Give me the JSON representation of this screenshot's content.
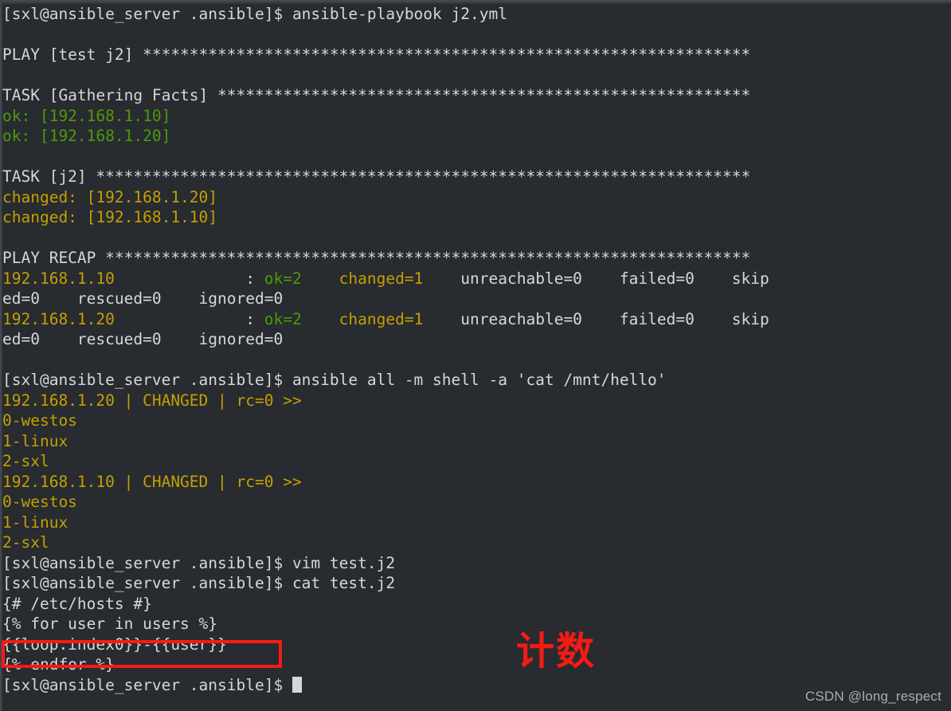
{
  "terminal": {
    "background_color": "#282b30",
    "default_text_color": "#d7d7d7",
    "ok_color": "#4e9a06",
    "changed_color": "#c4a000",
    "annotation_color": "#f51b14",
    "prompt": "[sxl@ansible_server .ansible]$ ",
    "lines": [
      {
        "id": "l01",
        "segments": [
          {
            "text": "[sxl@ansible_server .ansible]$ ansible-playbook j2.yml",
            "color": "white"
          }
        ]
      },
      {
        "id": "l02",
        "segments": [
          {
            "text": "",
            "color": "white"
          }
        ]
      },
      {
        "id": "l03",
        "segments": [
          {
            "text": "PLAY [test j2] *****************************************************************",
            "color": "white"
          }
        ]
      },
      {
        "id": "l04",
        "segments": [
          {
            "text": "",
            "color": "white"
          }
        ]
      },
      {
        "id": "l05",
        "segments": [
          {
            "text": "TASK [Gathering Facts] *********************************************************",
            "color": "white"
          }
        ]
      },
      {
        "id": "l06",
        "segments": [
          {
            "text": "ok: [192.168.1.10]",
            "color": "green"
          }
        ]
      },
      {
        "id": "l07",
        "segments": [
          {
            "text": "ok: [192.168.1.20]",
            "color": "green"
          }
        ]
      },
      {
        "id": "l08",
        "segments": [
          {
            "text": "",
            "color": "white"
          }
        ]
      },
      {
        "id": "l09",
        "segments": [
          {
            "text": "TASK [j2] **********************************************************************",
            "color": "white"
          }
        ]
      },
      {
        "id": "l10",
        "segments": [
          {
            "text": "changed: [192.168.1.20]",
            "color": "yellow"
          }
        ]
      },
      {
        "id": "l11",
        "segments": [
          {
            "text": "changed: [192.168.1.10]",
            "color": "yellow"
          }
        ]
      },
      {
        "id": "l12",
        "segments": [
          {
            "text": "",
            "color": "white"
          }
        ]
      },
      {
        "id": "l13",
        "segments": [
          {
            "text": "PLAY RECAP *********************************************************************",
            "color": "white"
          }
        ]
      },
      {
        "id": "l14",
        "segments": [
          {
            "text": "192.168.1.10",
            "color": "yellow"
          },
          {
            "text": "              : ",
            "color": "white"
          },
          {
            "text": "ok=2",
            "color": "green"
          },
          {
            "text": "    ",
            "color": "white"
          },
          {
            "text": "changed=1",
            "color": "yellow"
          },
          {
            "text": "    unreachable=0    failed=0    skip",
            "color": "white"
          }
        ]
      },
      {
        "id": "l15",
        "segments": [
          {
            "text": "ed=0    rescued=0    ignored=0   ",
            "color": "white"
          }
        ]
      },
      {
        "id": "l16",
        "segments": [
          {
            "text": "192.168.1.20",
            "color": "yellow"
          },
          {
            "text": "              : ",
            "color": "white"
          },
          {
            "text": "ok=2",
            "color": "green"
          },
          {
            "text": "    ",
            "color": "white"
          },
          {
            "text": "changed=1",
            "color": "yellow"
          },
          {
            "text": "    unreachable=0    failed=0    skip",
            "color": "white"
          }
        ]
      },
      {
        "id": "l17",
        "segments": [
          {
            "text": "ed=0    rescued=0    ignored=0   ",
            "color": "white"
          }
        ]
      },
      {
        "id": "l18",
        "segments": [
          {
            "text": "",
            "color": "white"
          }
        ]
      },
      {
        "id": "l19",
        "segments": [
          {
            "text": "[sxl@ansible_server .ansible]$ ansible all -m shell -a 'cat /mnt/hello'",
            "color": "white"
          }
        ]
      },
      {
        "id": "l20",
        "segments": [
          {
            "text": "192.168.1.20 | CHANGED | rc=0 >>",
            "color": "yellow"
          }
        ]
      },
      {
        "id": "l21",
        "segments": [
          {
            "text": "0-westos",
            "color": "yellow"
          }
        ]
      },
      {
        "id": "l22",
        "segments": [
          {
            "text": "1-linux",
            "color": "yellow"
          }
        ]
      },
      {
        "id": "l23",
        "segments": [
          {
            "text": "2-sxl",
            "color": "yellow"
          }
        ]
      },
      {
        "id": "l24",
        "segments": [
          {
            "text": "192.168.1.10 | CHANGED | rc=0 >>",
            "color": "yellow"
          }
        ]
      },
      {
        "id": "l25",
        "segments": [
          {
            "text": "0-westos",
            "color": "yellow"
          }
        ]
      },
      {
        "id": "l26",
        "segments": [
          {
            "text": "1-linux",
            "color": "yellow"
          }
        ]
      },
      {
        "id": "l27",
        "segments": [
          {
            "text": "2-sxl",
            "color": "yellow"
          }
        ]
      },
      {
        "id": "l28",
        "segments": [
          {
            "text": "[sxl@ansible_server .ansible]$ vim test.j2",
            "color": "white"
          }
        ]
      },
      {
        "id": "l29",
        "segments": [
          {
            "text": "[sxl@ansible_server .ansible]$ cat test.j2",
            "color": "white"
          }
        ]
      },
      {
        "id": "l30",
        "segments": [
          {
            "text": "{# /etc/hosts #}",
            "color": "white"
          }
        ]
      },
      {
        "id": "l31",
        "segments": [
          {
            "text": "{% for user in users %}",
            "color": "white"
          }
        ]
      },
      {
        "id": "l32",
        "segments": [
          {
            "text": "{{loop.index0}}-{{user}}",
            "color": "white"
          }
        ]
      },
      {
        "id": "l33",
        "segments": [
          {
            "text": "{% endfor %}",
            "color": "white"
          }
        ]
      }
    ],
    "final_prompt": "[sxl@ansible_server .ansible]$ ",
    "cursor": "block-cursor"
  },
  "annotations": {
    "highlight_box_target": "{{loop.index0}}-{{user}}",
    "annotation_text": "计数",
    "annotation_color": "#f51b14"
  },
  "watermark": {
    "text": "CSDN @long_respect"
  }
}
